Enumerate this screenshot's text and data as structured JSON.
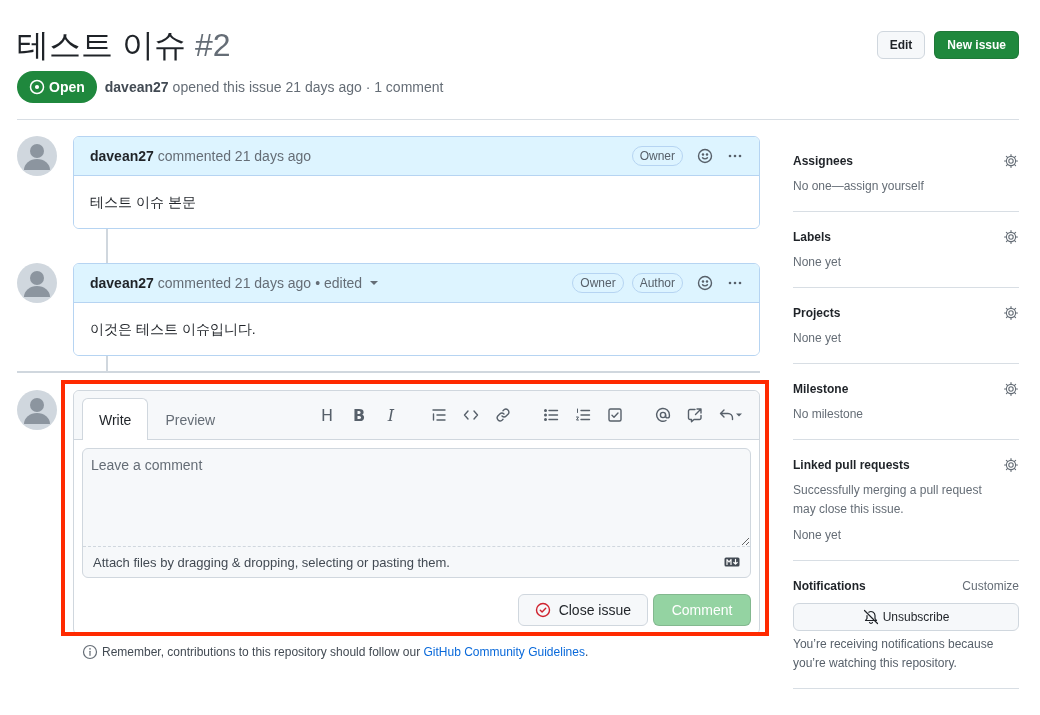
{
  "issue": {
    "title": "테스트 이슈",
    "number": "#2",
    "kind": "open",
    "state_label": "Open",
    "author": "davean27",
    "meta": "opened this issue 21 days ago · 1 comment"
  },
  "header_buttons": [
    {
      "label": "Edit",
      "kind": "default"
    },
    {
      "label": "New issue",
      "kind": "primary"
    }
  ],
  "comments": [
    {
      "author": "davean27",
      "meta": "commented 21 days ago",
      "badges": [
        "Owner"
      ],
      "body": "테스트 이슈 본문"
    },
    {
      "author": "davean27",
      "meta": "commented 21 days ago",
      "edited": "• edited",
      "badges": [
        "Owner",
        "Author"
      ],
      "body": "이것은 테스트 이슈입니다."
    }
  ],
  "comment_form": {
    "highlighted": true,
    "tabs": [
      {
        "label": "Write",
        "selected": true
      },
      {
        "label": "Preview",
        "selected": false
      }
    ],
    "toolbar": [
      {
        "kind": "heading",
        "glyph": "H"
      },
      {
        "kind": "bold",
        "glyph": "B"
      },
      {
        "kind": "italic",
        "glyph": "I"
      },
      {
        "kind": "quote"
      },
      {
        "kind": "code"
      },
      {
        "kind": "link"
      },
      {
        "kind": "bullets"
      },
      {
        "kind": "numbered"
      },
      {
        "kind": "tasks"
      },
      {
        "kind": "mention"
      },
      {
        "kind": "reference"
      },
      {
        "kind": "reply"
      }
    ],
    "placeholder": "Leave a comment",
    "attach_hint": "Attach files by dragging & dropping, selecting or pasting them.",
    "buttons": [
      {
        "label": "Close issue",
        "kind": "close",
        "disabled": false
      },
      {
        "label": "Comment",
        "kind": "submit",
        "disabled": true
      }
    ]
  },
  "guidelines": {
    "text": "Remember, contributions to this repository should follow our ",
    "link": "GitHub Community Guidelines",
    "after": "."
  },
  "sidebar": {
    "sections": [
      {
        "heading": "Assignees",
        "settings": true,
        "lines": [
          "No one—assign yourself"
        ]
      },
      {
        "heading": "Labels",
        "settings": true,
        "lines": [
          "None yet"
        ]
      },
      {
        "heading": "Projects",
        "settings": true,
        "lines": [
          "None yet"
        ]
      },
      {
        "heading": "Milestone",
        "settings": true,
        "lines": [
          "No milestone"
        ]
      },
      {
        "heading": "Linked pull requests",
        "settings": true,
        "lines": [
          "Successfully merging a pull request may close this issue.",
          "None yet"
        ]
      }
    ],
    "notifications": {
      "heading": "Notifications",
      "action": "Customize",
      "button": "Unsubscribe",
      "note": "You’re receiving notifications because you’re watching this repository."
    }
  }
}
